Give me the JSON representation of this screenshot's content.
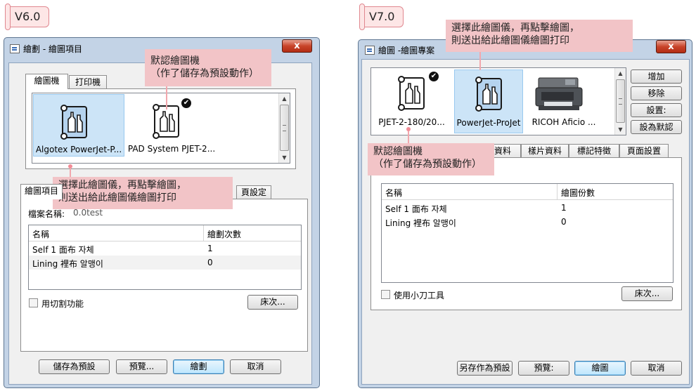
{
  "left": {
    "version": "V6.0",
    "title": "繪劃 - 繪圖項目",
    "close": "x",
    "top_tabs": [
      "繪圖機",
      "打印機"
    ],
    "printers": [
      {
        "label": "Algotex PowerJet-P...",
        "selected": true,
        "default": false
      },
      {
        "label": "PAD System PJET-2...",
        "selected": false,
        "default": true
      }
    ],
    "bottom_tabs": [
      "繪圖項目",
      "頁設定"
    ],
    "file_label": "檔案名稱:",
    "file_value": "0.0test",
    "grid_headers": [
      "名稱",
      "繪劃次數"
    ],
    "rows": [
      [
        "Self 1 面布 자체",
        "1"
      ],
      [
        "Lining 裡布 알맹이",
        "0"
      ]
    ],
    "checkbox_label": "用切割功能",
    "bed_button": "床次...",
    "buttons": [
      "儲存為預設",
      "預覽...",
      "繪劃",
      "取消"
    ],
    "callout_default": [
      "默認繪圖機",
      "（作了儲存為預設動作）"
    ],
    "callout_select": [
      "選擇此繪圖儀，再點擊繪圖，",
      "則送出給此繪圖儀繪圖打印"
    ]
  },
  "right": {
    "version": "V7.0",
    "title": "繪圖 -繪圖專案",
    "close": "x",
    "printers": [
      {
        "label": "PJET-2-180/20...",
        "selected": false,
        "default": true
      },
      {
        "label": "PowerJet-ProJet",
        "selected": true,
        "default": false
      },
      {
        "label": "RICOH Aficio ...",
        "selected": false,
        "default": false
      }
    ],
    "side_buttons": [
      "增加",
      "移除",
      "設置:",
      "設為默認"
    ],
    "tabs": [
      "資料",
      "樣片資料",
      "標記特徵",
      "頁面設置"
    ],
    "grid_headers": [
      "名稱",
      "繪圖份數"
    ],
    "rows": [
      [
        "Self 1 面布 자체",
        "1"
      ],
      [
        "Lining 裡布 알맹이",
        "0"
      ]
    ],
    "checkbox_label": "使用小刀工具",
    "bed_button": "床次...",
    "buttons": [
      "另存作為預設",
      "預覽:",
      "繪圖",
      "取消"
    ],
    "callout_select": [
      "選擇此繪圖儀，再點擊繪圖，",
      "則送出給此繪圖儀繪圖打印"
    ],
    "callout_default": [
      "默認繪圖機",
      "（作了儲存為預設動作）"
    ]
  }
}
